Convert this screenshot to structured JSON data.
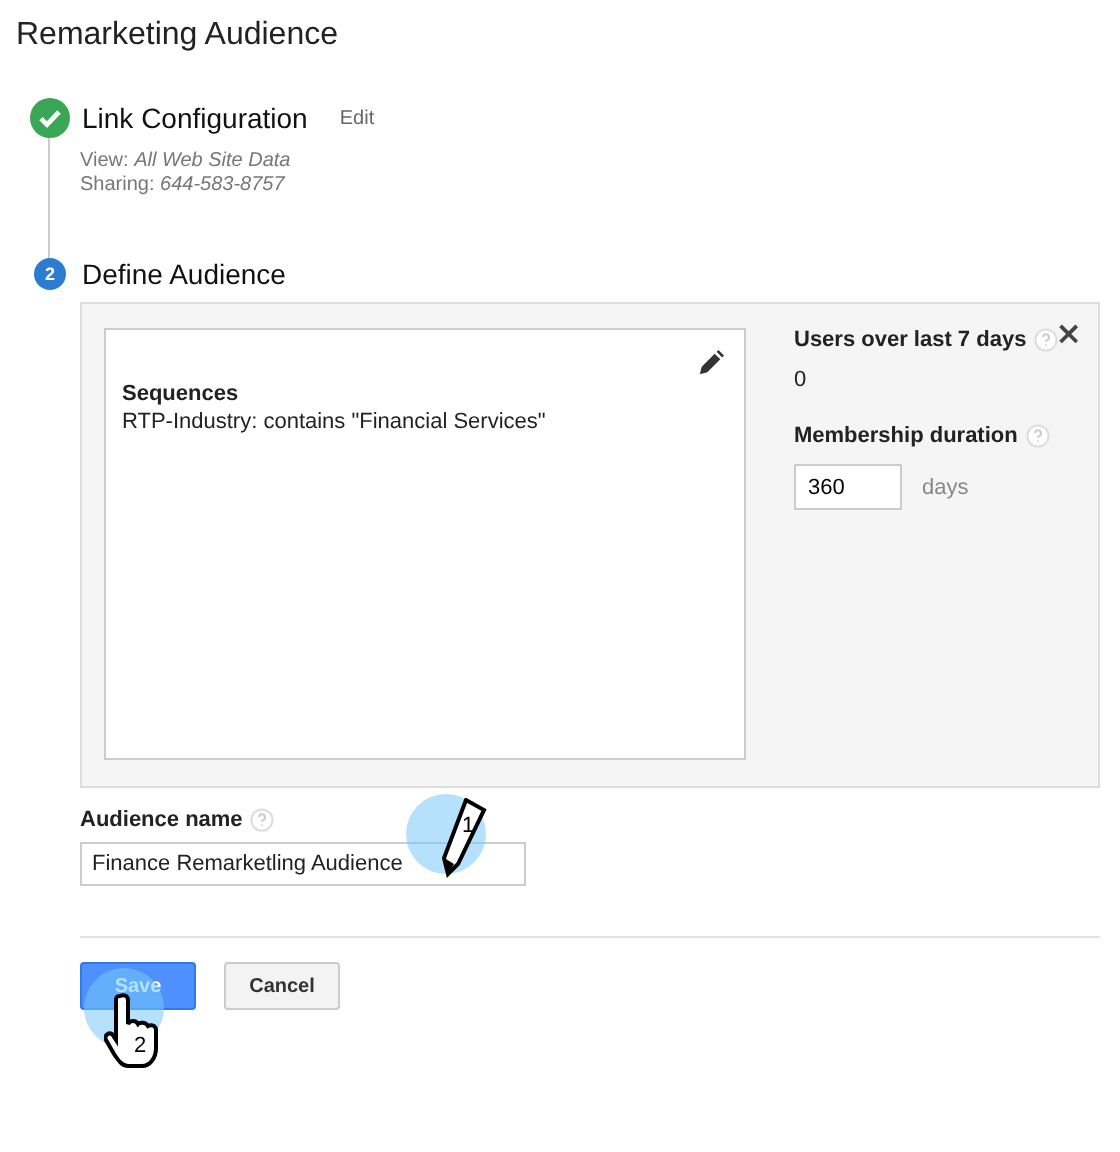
{
  "page_title": "Remarketing Audience",
  "steps": [
    {
      "title": "Link Configuration",
      "completed": true,
      "action": "Edit",
      "details": [
        {
          "label": "View:",
          "value": "All Web Site Data"
        },
        {
          "label": "Sharing:",
          "value": "644-583-8757"
        }
      ]
    },
    {
      "number": "2",
      "title": "Define Audience",
      "completed": false
    }
  ],
  "definition": {
    "heading": "Sequences",
    "condition": "RTP-Industry: contains \"Financial Services\"",
    "close": "×"
  },
  "users_stat": {
    "label": "Users over last 7 days",
    "value": "0"
  },
  "membership": {
    "label": "Membership duration",
    "value": "360",
    "unit": "days"
  },
  "audience_name": {
    "label": "Audience name",
    "value": "Finance Remarketling Audience"
  },
  "buttons": [
    {
      "label": "Save",
      "kind": "primary"
    },
    {
      "label": "Cancel",
      "kind": "secondary"
    }
  ],
  "callouts": [
    {
      "label": "1",
      "kind": "pencil"
    },
    {
      "label": "2",
      "kind": "hand"
    }
  ]
}
